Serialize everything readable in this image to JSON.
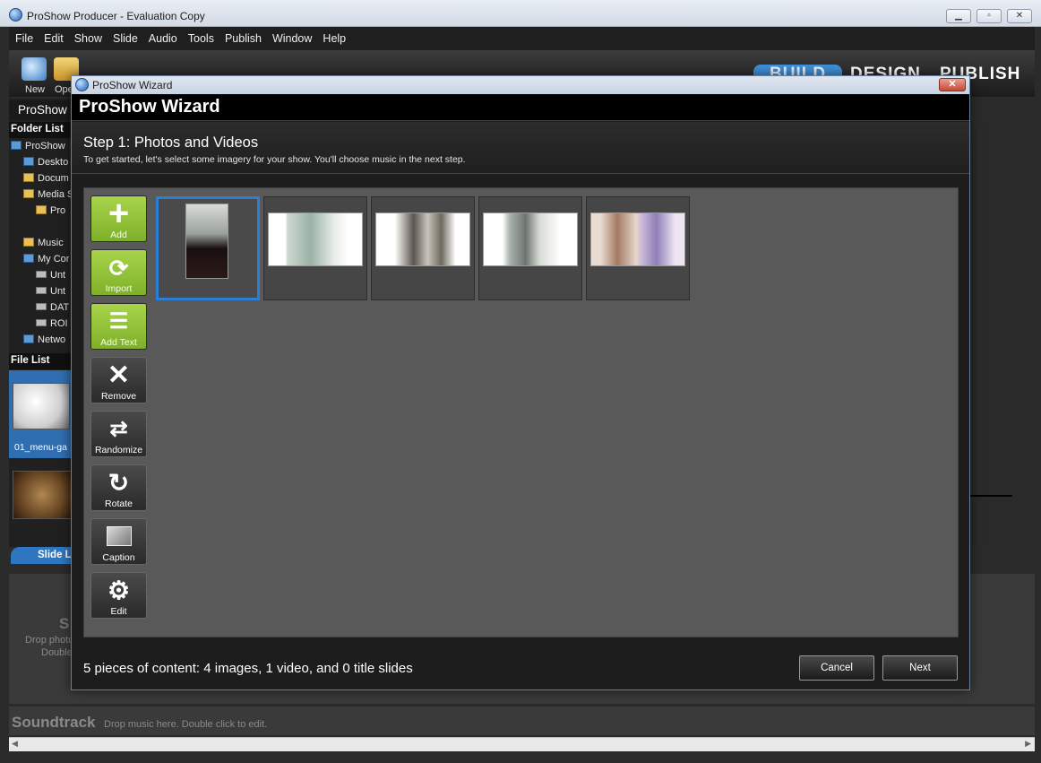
{
  "app": {
    "title": "ProShow Producer - Evaluation Copy",
    "menu": [
      "File",
      "Edit",
      "Show",
      "Slide",
      "Audio",
      "Tools",
      "Publish",
      "Window",
      "Help"
    ],
    "toolbar": {
      "new_label": "New",
      "open_label": "Ope"
    },
    "modes": {
      "build": "BUILD",
      "design": "DESIGN",
      "publish": "PUBLISH"
    },
    "show_name": "ProShow"
  },
  "left_panel": {
    "folder_list_title": "Folder List",
    "folders": [
      "ProShow",
      "Deskto",
      "Docum",
      "Media S",
      "Pro",
      "Music",
      "My Cor",
      "Unt",
      "Unt",
      "DAT",
      "ROI",
      "Netwo"
    ],
    "file_list_title": "File List",
    "file_name": "01_menu-ga"
  },
  "slide_list": {
    "tab_label": "Slide L",
    "hint_big": "S",
    "hint_line1": "Drop photo",
    "hint_line2": "Double"
  },
  "soundtrack": {
    "title": "Soundtrack",
    "hint": "Drop music here.  Double click to edit."
  },
  "wizard": {
    "window_title": "ProShow Wizard",
    "header": "ProShow Wizard",
    "step_title": "Step 1: Photos and Videos",
    "step_subtitle": "To get started, let's select some imagery for your show. You'll choose music in the next step.",
    "tools": [
      {
        "label": "Add",
        "icon": "plus-icon"
      },
      {
        "label": "Import",
        "icon": "import-icon"
      },
      {
        "label": "Add Text",
        "icon": "add-text-icon"
      },
      {
        "label": "Remove",
        "icon": "remove-icon"
      },
      {
        "label": "Randomize",
        "icon": "shuffle-icon"
      },
      {
        "label": "Rotate",
        "icon": "rotate-icon"
      },
      {
        "label": "Caption",
        "icon": "caption-icon"
      },
      {
        "label": "Edit",
        "icon": "gear-icon"
      }
    ],
    "summary": "5 pieces of content: 4 images, 1 video, and 0 title slides",
    "cancel_label": "Cancel",
    "next_label": "Next"
  },
  "colors": {
    "accent_blue": "#2a7fd4",
    "tool_green": "#8fc13a"
  }
}
